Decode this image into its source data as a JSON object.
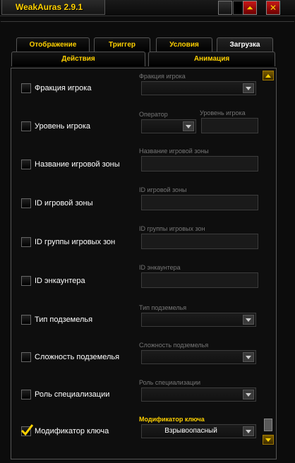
{
  "window": {
    "title": "WeakAuras 2.9.1"
  },
  "tabs_row1": [
    "Отображение",
    "Триггер",
    "Условия",
    "Загрузка"
  ],
  "tabs_row2": [
    "Действия",
    "Анимация"
  ],
  "rows": [
    {
      "label": "Фракция игрока",
      "caption": "Фракция игрока",
      "checked": false
    },
    {
      "label": "Уровень игрока",
      "caption": "Оператор",
      "caption2": "Уровень игрока",
      "checked": false
    },
    {
      "label": "Название игровой зоны",
      "caption": "Название игровой зоны",
      "checked": false
    },
    {
      "label": "ID игровой зоны",
      "caption": "ID игровой зоны",
      "checked": false
    },
    {
      "label": "ID группы игровых зон",
      "caption": "ID группы игровых зон",
      "checked": false
    },
    {
      "label": "ID энкаунтера",
      "caption": "ID энкаунтера",
      "checked": false
    },
    {
      "label": "Тип подземелья",
      "caption": "Тип подземелья",
      "checked": false
    },
    {
      "label": "Сложность подземелья",
      "caption": "Сложность подземелья",
      "checked": false
    },
    {
      "label": "Роль специализации",
      "caption": "Роль специализации",
      "checked": false
    },
    {
      "label": "Модификатор ключа",
      "caption": "Модификатор ключа",
      "checked": true,
      "value": "Взрывоопасный"
    }
  ],
  "colors": {
    "gold": "#ffd100",
    "red": "#c81818"
  }
}
